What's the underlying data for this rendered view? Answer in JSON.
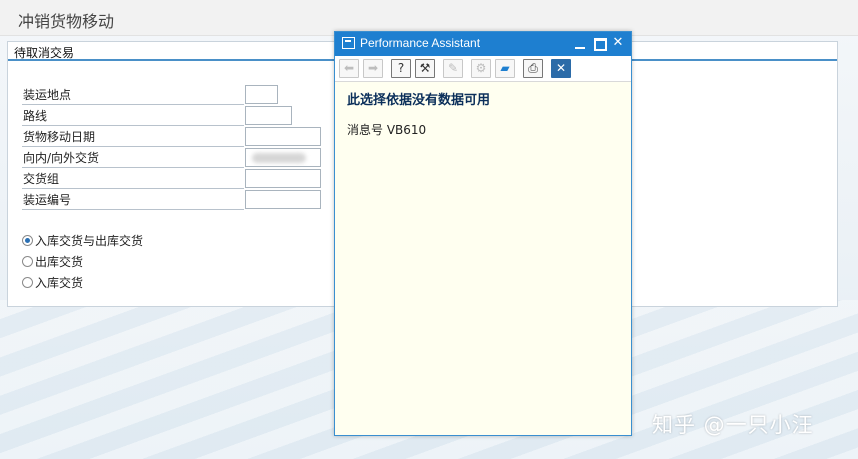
{
  "page": {
    "title": "冲销货物移动"
  },
  "group": {
    "title": "待取消交易"
  },
  "fields": [
    {
      "label": "装运地点",
      "value": ""
    },
    {
      "label": "路线",
      "value": ""
    },
    {
      "label": "货物移动日期",
      "value": ""
    },
    {
      "label": "向内/向外交货",
      "value": ""
    },
    {
      "label": "交货组",
      "value": ""
    },
    {
      "label": "装运编号",
      "value": ""
    }
  ],
  "radios": [
    {
      "label": "入库交货与出库交货",
      "selected": true
    },
    {
      "label": "出库交货",
      "selected": false
    },
    {
      "label": "入库交货",
      "selected": false
    }
  ],
  "assistant": {
    "title": "Performance Assistant",
    "message": "此选择依据没有数据可用",
    "message_no": "消息号 VB610",
    "toolbar_icons": [
      "back-icon",
      "forward-icon",
      "help-document-icon",
      "technical-info-icon",
      "edit-icon",
      "settings-icon",
      "open-folder-icon",
      "print-icon",
      "exit-icon"
    ]
  },
  "watermark": "知乎 @一只小汪",
  "colors": {
    "accent": "#1e7fd0",
    "popup_bg": "#fffff0",
    "message_text": "#0b2f5a"
  }
}
